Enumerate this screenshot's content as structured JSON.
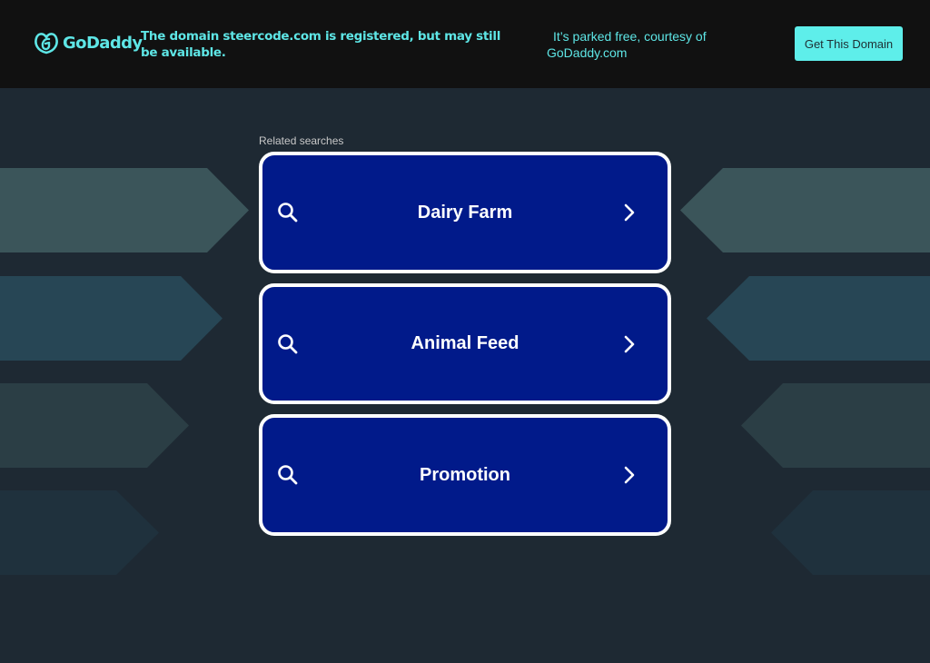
{
  "header": {
    "brand": "GoDaddy",
    "domain_message": "The domain steercode.com is registered, but may still be available.",
    "parked_line1": "It’s parked free, courtesy of",
    "parked_line2": "GoDaddy.com",
    "cta_label": "Get This Domain"
  },
  "main": {
    "related_label": "Related searches",
    "searches": [
      {
        "label": "Dairy Farm",
        "icon": "search-icon",
        "trailing_icon": "chevron-right-icon"
      },
      {
        "label": "Animal Feed",
        "icon": "search-icon",
        "trailing_icon": "chevron-right-icon"
      },
      {
        "label": "Promotion",
        "icon": "search-icon",
        "trailing_icon": "chevron-right-icon"
      }
    ]
  },
  "colors": {
    "header_bg": "#111111",
    "page_bg": "#1e2933",
    "accent": "#5ee6e6",
    "button_fill": "#011a8a",
    "button_border": "#ffffff",
    "arrow_colors": [
      "#3b555a",
      "#274655",
      "#2b3e45",
      "#1f313d"
    ]
  }
}
